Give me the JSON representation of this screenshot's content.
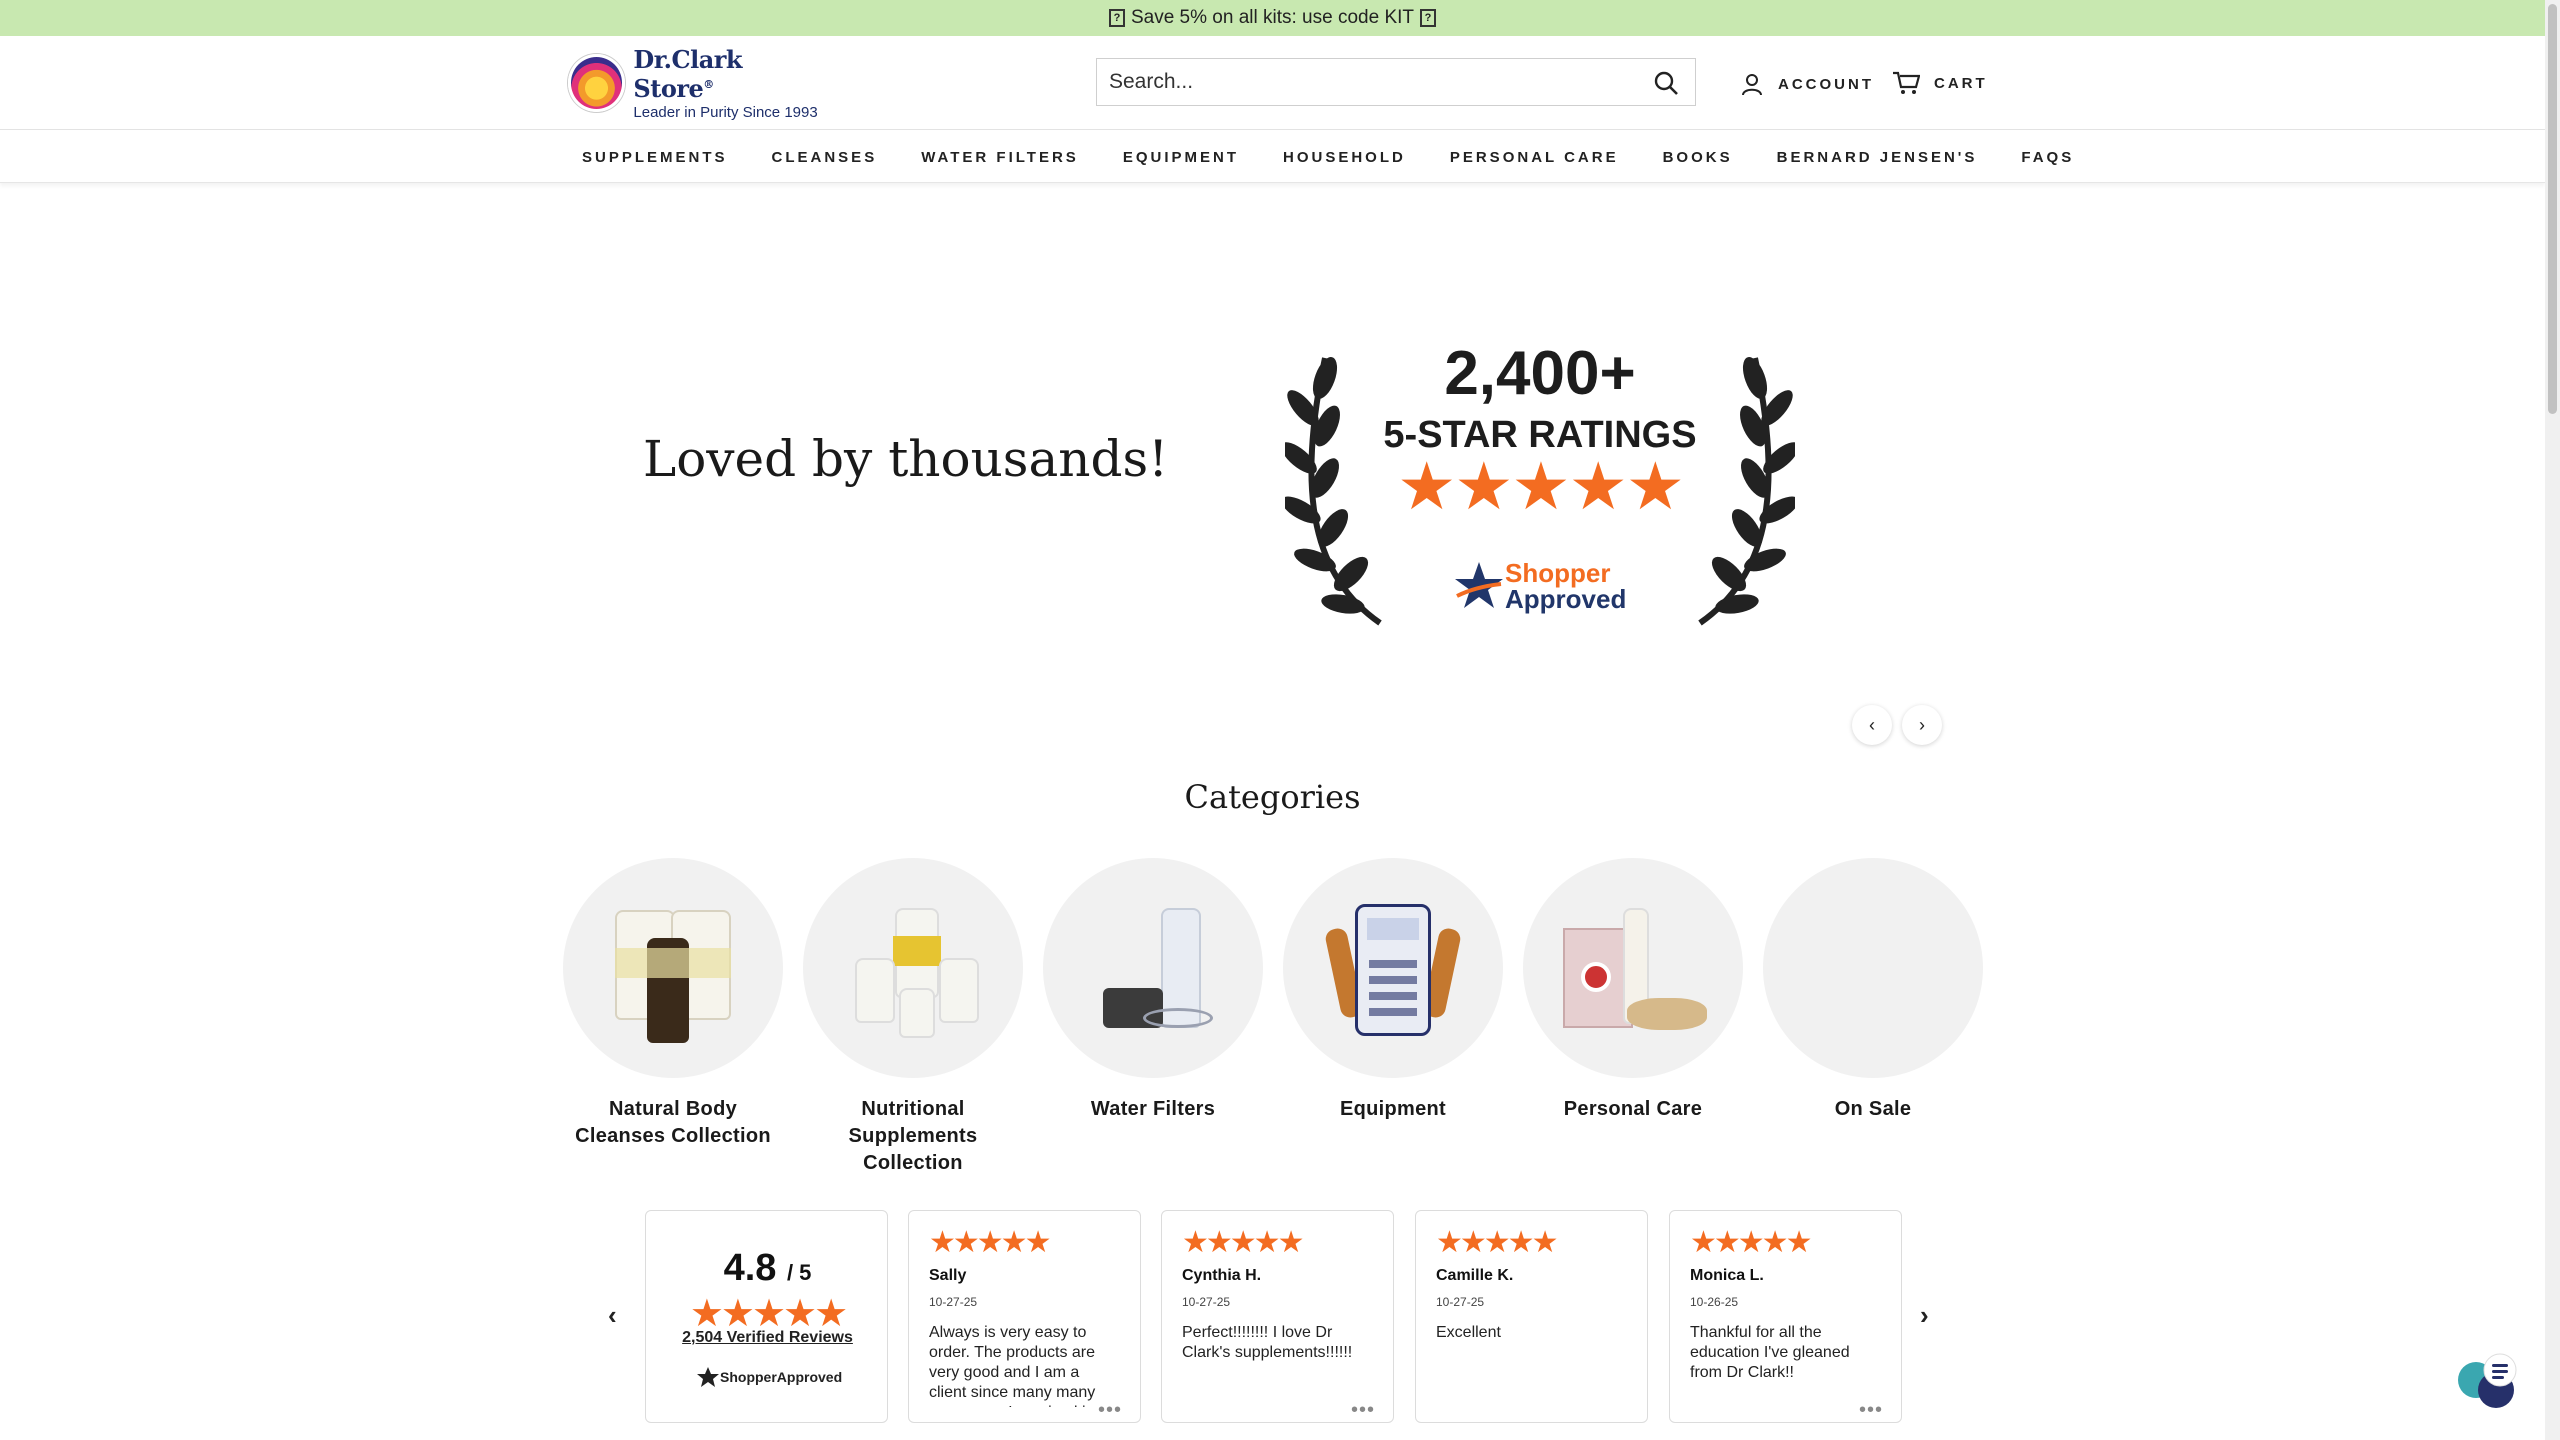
{
  "announcement": {
    "text": "Save 5% on all kits: use code KIT",
    "box_glyph": "?"
  },
  "header": {
    "logo_name": "Dr.Clark Store",
    "logo_mark": "®",
    "logo_tagline": "Leader in Purity Since 1993",
    "search_placeholder": "Search...",
    "account_label": "ACCOUNT",
    "cart_label": "CART"
  },
  "nav": {
    "items": [
      "SUPPLEMENTS",
      "CLEANSES",
      "WATER FILTERS",
      "EQUIPMENT",
      "HOUSEHOLD",
      "PERSONAL CARE",
      "BOOKS",
      "BERNARD JENSEN'S",
      "FAQS"
    ]
  },
  "hero": {
    "title": "Loved by thousands!",
    "badge_count": "2,400+",
    "badge_label": "5-STAR RATINGS",
    "badge_stars": "★★★★★",
    "badge_brand_line1": "Shopper",
    "badge_brand_line2": "Approved",
    "prev_glyph": "‹",
    "next_glyph": "›"
  },
  "categories": {
    "title": "Categories",
    "items": [
      {
        "label": "Natural Body Cleanses Collection"
      },
      {
        "label": "Nutritional Supplements Collection"
      },
      {
        "label": "Water Filters"
      },
      {
        "label": "Equipment"
      },
      {
        "label": "Personal Care"
      },
      {
        "label": "On Sale"
      }
    ]
  },
  "reviews": {
    "score": "4.8",
    "score_of": "/ 5",
    "score_stars": "★★★★★",
    "count_link": "2,504 Verified Reviews",
    "brand": "ShopperApproved",
    "prev_glyph": "‹",
    "next_glyph": "›",
    "items": [
      {
        "stars": "★★★★★",
        "name": "Sally",
        "date": "10-27-25",
        "text": "Always is very easy to order. The products are very good and I am a client since many many years ago. I received in",
        "more": "•••"
      },
      {
        "stars": "★★★★★",
        "name": "Cynthia H.",
        "date": "10-27-25",
        "text": "Perfect!!!!!!!! I love Dr Clark's supplements!!!!!!",
        "more": "•••"
      },
      {
        "stars": "★★★★★",
        "name": "Camille K.",
        "date": "10-27-25",
        "text": "Excellent",
        "more": ""
      },
      {
        "stars": "★★★★★",
        "name": "Monica L.",
        "date": "10-26-25",
        "text": "Thankful for all the education I've gleaned from Dr Clark!!",
        "more": "•••"
      }
    ]
  },
  "colors": {
    "announce_bg": "#c8e8b0",
    "brand_navy": "#1e2f6b",
    "star_orange": "#f36c21"
  }
}
